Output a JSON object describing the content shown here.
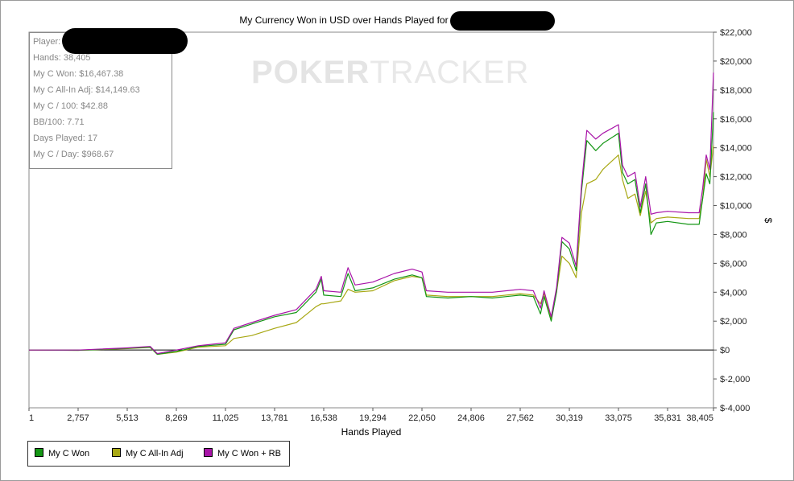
{
  "chart_data": {
    "type": "line",
    "title": "My Currency Won in USD over Hands Played for",
    "xlabel": "Hands Played",
    "ylabel": "$",
    "x_ticks": [
      "1",
      "2,757",
      "5,513",
      "8,269",
      "11,025",
      "13,781",
      "16,538",
      "19,294",
      "22,050",
      "24,806",
      "27,562",
      "30,319",
      "33,075",
      "35,831",
      "38,405"
    ],
    "y_ticks": [
      "$-4,000",
      "$-2,000",
      "$0",
      "$2,000",
      "$4,000",
      "$6,000",
      "$8,000",
      "$10,000",
      "$12,000",
      "$14,000",
      "$16,000",
      "$18,000",
      "$20,000",
      "$22,000"
    ],
    "xlim": [
      1,
      38405
    ],
    "ylim": [
      -4000,
      22000
    ],
    "grid": false,
    "legend_position": "bottom-left",
    "series": [
      {
        "name": "My C Won",
        "color": "#149614",
        "points": [
          [
            1,
            0
          ],
          [
            2757,
            -20
          ],
          [
            5513,
            120
          ],
          [
            6800,
            200
          ],
          [
            7200,
            -300
          ],
          [
            8269,
            -100
          ],
          [
            9500,
            250
          ],
          [
            11025,
            400
          ],
          [
            11500,
            1400
          ],
          [
            12500,
            1800
          ],
          [
            13781,
            2300
          ],
          [
            15000,
            2600
          ],
          [
            16100,
            4000
          ],
          [
            16400,
            4900
          ],
          [
            16538,
            3800
          ],
          [
            17500,
            3700
          ],
          [
            17900,
            5300
          ],
          [
            18300,
            4100
          ],
          [
            19294,
            4300
          ],
          [
            20500,
            4900
          ],
          [
            21500,
            5200
          ],
          [
            22050,
            5000
          ],
          [
            22300,
            3700
          ],
          [
            23500,
            3600
          ],
          [
            24806,
            3700
          ],
          [
            26000,
            3600
          ],
          [
            27562,
            3800
          ],
          [
            28300,
            3700
          ],
          [
            28700,
            2500
          ],
          [
            28900,
            3700
          ],
          [
            29300,
            2000
          ],
          [
            29600,
            4000
          ],
          [
            29900,
            7500
          ],
          [
            30319,
            7000
          ],
          [
            30700,
            5500
          ],
          [
            31000,
            11000
          ],
          [
            31300,
            14500
          ],
          [
            31800,
            13800
          ],
          [
            32200,
            14300
          ],
          [
            33075,
            15000
          ],
          [
            33300,
            12300
          ],
          [
            33600,
            11500
          ],
          [
            34000,
            11800
          ],
          [
            34300,
            9500
          ],
          [
            34600,
            11500
          ],
          [
            34900,
            8000
          ],
          [
            35200,
            8800
          ],
          [
            35831,
            8900
          ],
          [
            37000,
            8700
          ],
          [
            37600,
            8700
          ],
          [
            37800,
            10500
          ],
          [
            38000,
            12200
          ],
          [
            38200,
            11500
          ],
          [
            38405,
            16467
          ]
        ]
      },
      {
        "name": "My C All-In Adj",
        "color": "#a8a814",
        "points": [
          [
            1,
            0
          ],
          [
            2757,
            -20
          ],
          [
            5513,
            100
          ],
          [
            6800,
            180
          ],
          [
            7200,
            -300
          ],
          [
            8269,
            -150
          ],
          [
            9500,
            200
          ],
          [
            11025,
            300
          ],
          [
            11500,
            800
          ],
          [
            12500,
            1000
          ],
          [
            13781,
            1500
          ],
          [
            15000,
            1900
          ],
          [
            16100,
            3000
          ],
          [
            16400,
            3200
          ],
          [
            16538,
            3200
          ],
          [
            17500,
            3400
          ],
          [
            17900,
            4200
          ],
          [
            18300,
            4000
          ],
          [
            19294,
            4100
          ],
          [
            20500,
            4800
          ],
          [
            21500,
            5100
          ],
          [
            22050,
            5000
          ],
          [
            22300,
            3800
          ],
          [
            23500,
            3700
          ],
          [
            24806,
            3700
          ],
          [
            26000,
            3700
          ],
          [
            27562,
            3900
          ],
          [
            28300,
            3800
          ],
          [
            28700,
            3200
          ],
          [
            28900,
            3900
          ],
          [
            29300,
            2200
          ],
          [
            29600,
            4000
          ],
          [
            29900,
            6500
          ],
          [
            30319,
            6000
          ],
          [
            30700,
            5000
          ],
          [
            31000,
            9500
          ],
          [
            31300,
            11500
          ],
          [
            31800,
            11800
          ],
          [
            32200,
            12500
          ],
          [
            33075,
            13500
          ],
          [
            33300,
            11800
          ],
          [
            33600,
            10500
          ],
          [
            34000,
            10800
          ],
          [
            34300,
            9300
          ],
          [
            34600,
            11000
          ],
          [
            34900,
            8800
          ],
          [
            35200,
            9100
          ],
          [
            35831,
            9200
          ],
          [
            37000,
            9100
          ],
          [
            37600,
            9100
          ],
          [
            37800,
            10500
          ],
          [
            38000,
            13200
          ],
          [
            38200,
            12000
          ],
          [
            38405,
            14150
          ]
        ]
      },
      {
        "name": "My C Won + RB",
        "color": "#a814a8",
        "points": [
          [
            1,
            0
          ],
          [
            2757,
            0
          ],
          [
            5513,
            150
          ],
          [
            6800,
            250
          ],
          [
            7200,
            -250
          ],
          [
            8269,
            0
          ],
          [
            9500,
            300
          ],
          [
            11025,
            500
          ],
          [
            11500,
            1500
          ],
          [
            12500,
            1900
          ],
          [
            13781,
            2400
          ],
          [
            15000,
            2800
          ],
          [
            16100,
            4200
          ],
          [
            16400,
            5100
          ],
          [
            16538,
            4100
          ],
          [
            17500,
            4000
          ],
          [
            17900,
            5700
          ],
          [
            18300,
            4500
          ],
          [
            19294,
            4700
          ],
          [
            20500,
            5300
          ],
          [
            21500,
            5600
          ],
          [
            22050,
            5400
          ],
          [
            22300,
            4100
          ],
          [
            23500,
            4000
          ],
          [
            24806,
            4000
          ],
          [
            26000,
            4000
          ],
          [
            27562,
            4200
          ],
          [
            28300,
            4100
          ],
          [
            28700,
            2900
          ],
          [
            28900,
            4100
          ],
          [
            29300,
            2300
          ],
          [
            29600,
            4300
          ],
          [
            29900,
            7800
          ],
          [
            30319,
            7400
          ],
          [
            30700,
            5800
          ],
          [
            31000,
            11400
          ],
          [
            31300,
            15200
          ],
          [
            31800,
            14600
          ],
          [
            32200,
            15000
          ],
          [
            33075,
            15600
          ],
          [
            33300,
            12800
          ],
          [
            33600,
            12000
          ],
          [
            34000,
            12300
          ],
          [
            34300,
            9900
          ],
          [
            34600,
            12000
          ],
          [
            34900,
            9400
          ],
          [
            35200,
            9500
          ],
          [
            35831,
            9600
          ],
          [
            37000,
            9500
          ],
          [
            37600,
            9500
          ],
          [
            37800,
            11200
          ],
          [
            38000,
            13500
          ],
          [
            38200,
            12500
          ],
          [
            38405,
            19200
          ]
        ]
      }
    ]
  },
  "stats": [
    "Player:",
    "Hands: 38,405",
    "My C Won: $16,467.38",
    "My C All-In Adj: $14,149.63",
    "My C / 100: $42.88",
    "BB/100: 7.71",
    "Days Played: 17",
    "My C / Day: $968.67"
  ],
  "watermark": {
    "bold": "POKER",
    "thin": "TRACKER"
  },
  "legend": [
    "My C Won",
    "My C All-In Adj",
    "My C Won + RB"
  ]
}
